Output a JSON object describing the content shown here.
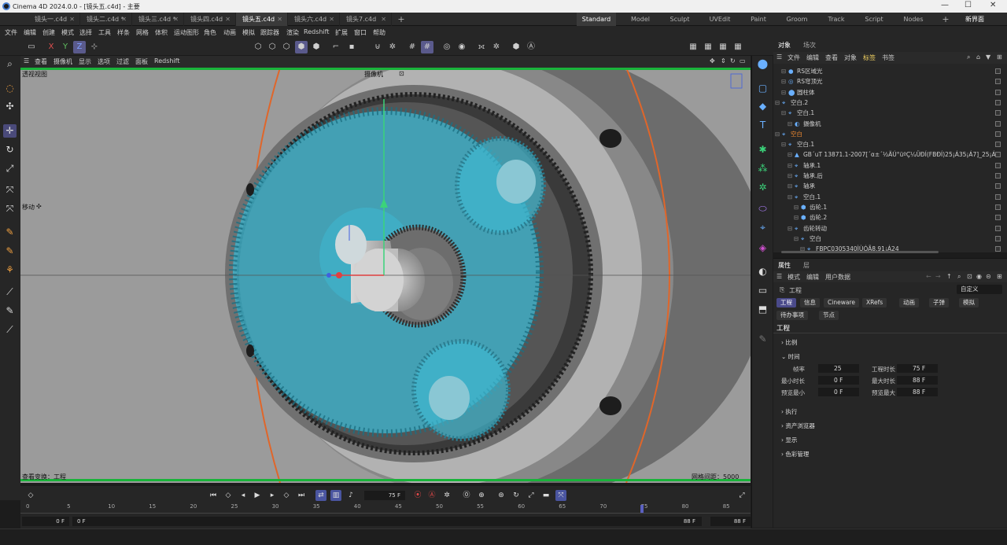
{
  "window": {
    "title": "Cinema 4D 2024.0.0 - [镜头五.c4d] - 主要",
    "min": "—",
    "max": "☐",
    "close": "✕"
  },
  "doc_tabs": [
    {
      "label": "镜头一.c4d"
    },
    {
      "label": "镜头二.c4d *"
    },
    {
      "label": "镜头三.c4d *"
    },
    {
      "label": "镜头四.c4d"
    },
    {
      "label": "镜头五.c4d"
    },
    {
      "label": "镜头六.c4d"
    },
    {
      "label": "镜头7.c4d"
    }
  ],
  "add_tab": "+",
  "layouts": [
    "Standard",
    "Model",
    "Sculpt",
    "UVEdit",
    "Paint",
    "Groom",
    "Track",
    "Script",
    "Nodes"
  ],
  "layout_add": "+",
  "new_ui": "新界面",
  "menu": [
    "文件",
    "编辑",
    "创建",
    "模式",
    "选择",
    "工具",
    "样条",
    "网格",
    "体积",
    "运动图形",
    "角色",
    "动画",
    "模拟",
    "跟踪器",
    "渲染",
    "Redshift",
    "扩展",
    "窗口",
    "帮助"
  ],
  "axis": {
    "x": "X",
    "y": "Y",
    "z": "Z"
  },
  "viewport_menu": [
    "查看",
    "摄像机",
    "显示",
    "选项",
    "过滤",
    "面板",
    "Redshift"
  ],
  "viewport": {
    "label": "透视视图",
    "camera": "摄像机",
    "move_label": "移动",
    "view_transform": "查看变换：工程",
    "grid": "网格间距：5000 cm"
  },
  "timeline": {
    "ticks": [
      "0",
      "5",
      "10",
      "15",
      "20",
      "25",
      "30",
      "35",
      "40",
      "45",
      "50",
      "55",
      "60",
      "65",
      "70",
      "75",
      "80",
      "85"
    ],
    "current_frame": "75 F",
    "start": "0 F",
    "start2": "0 F",
    "end": "88 F",
    "end2": "88 F"
  },
  "object_panel": {
    "tabs": [
      "对象",
      "场次"
    ],
    "menu": [
      "文件",
      "编辑",
      "查看",
      "对象",
      "标签",
      "书签"
    ],
    "rows": [
      {
        "name": "RS区域光",
        "indent": 1
      },
      {
        "name": "RS穹顶光",
        "indent": 1
      },
      {
        "name": "圆柱体",
        "indent": 1
      },
      {
        "name": "空白.2",
        "indent": 0
      },
      {
        "name": "空白.1",
        "indent": 1
      },
      {
        "name": "摄像机",
        "indent": 2
      },
      {
        "name": "空白",
        "indent": 0
      },
      {
        "name": "空白.1",
        "indent": 1
      },
      {
        "name": "GB´uT 13871.1-2007[´α±´½ÄÚ°üºÇ¼ÜĐÍ(FBĐÍ)25¡Á35¡Á7]_25¡Á40",
        "indent": 2
      },
      {
        "name": "轴承.1",
        "indent": 2
      },
      {
        "name": "轴承.后",
        "indent": 2
      },
      {
        "name": "轴承",
        "indent": 2
      },
      {
        "name": "空白.1",
        "indent": 2
      },
      {
        "name": "齿轮.1",
        "indent": 3
      },
      {
        "name": "齿轮.2",
        "indent": 3
      },
      {
        "name": "齿轮转动",
        "indent": 2
      },
      {
        "name": "空白",
        "indent": 3
      },
      {
        "name": "FBPC0305340ÌÙÓÃ8.91¡Á24",
        "indent": 4
      }
    ]
  },
  "attr_panel": {
    "tabs": [
      "属性",
      "层"
    ],
    "menu": [
      "模式",
      "编辑",
      "用户数据"
    ],
    "object": "工程",
    "preset": "自定义",
    "buttons": [
      "工程",
      "信息",
      "Cineware",
      "XRefs",
      "动画",
      "子弹",
      "模拟",
      "待办事项",
      "节点"
    ],
    "section_title": "工程",
    "sections": [
      "比例",
      "时间",
      "执行",
      "资产浏览器",
      "显示",
      "色彩管理"
    ],
    "fields": {
      "fps_label": "帧率",
      "fps": "25",
      "duration_label": "工程时长",
      "duration": "75 F",
      "min_label": "最小时长",
      "min": "0 F",
      "max_label": "最大时长",
      "max": "88 F",
      "pmin_label": "预览最小",
      "pmin": "0 F",
      "pmax_label": "预览最大",
      "pmax": "88 F"
    }
  },
  "colors": {
    "accent": "#5a5a8c",
    "frame": "#19b33a",
    "teal": "#3fb6cf",
    "orange": "#e0662a"
  }
}
